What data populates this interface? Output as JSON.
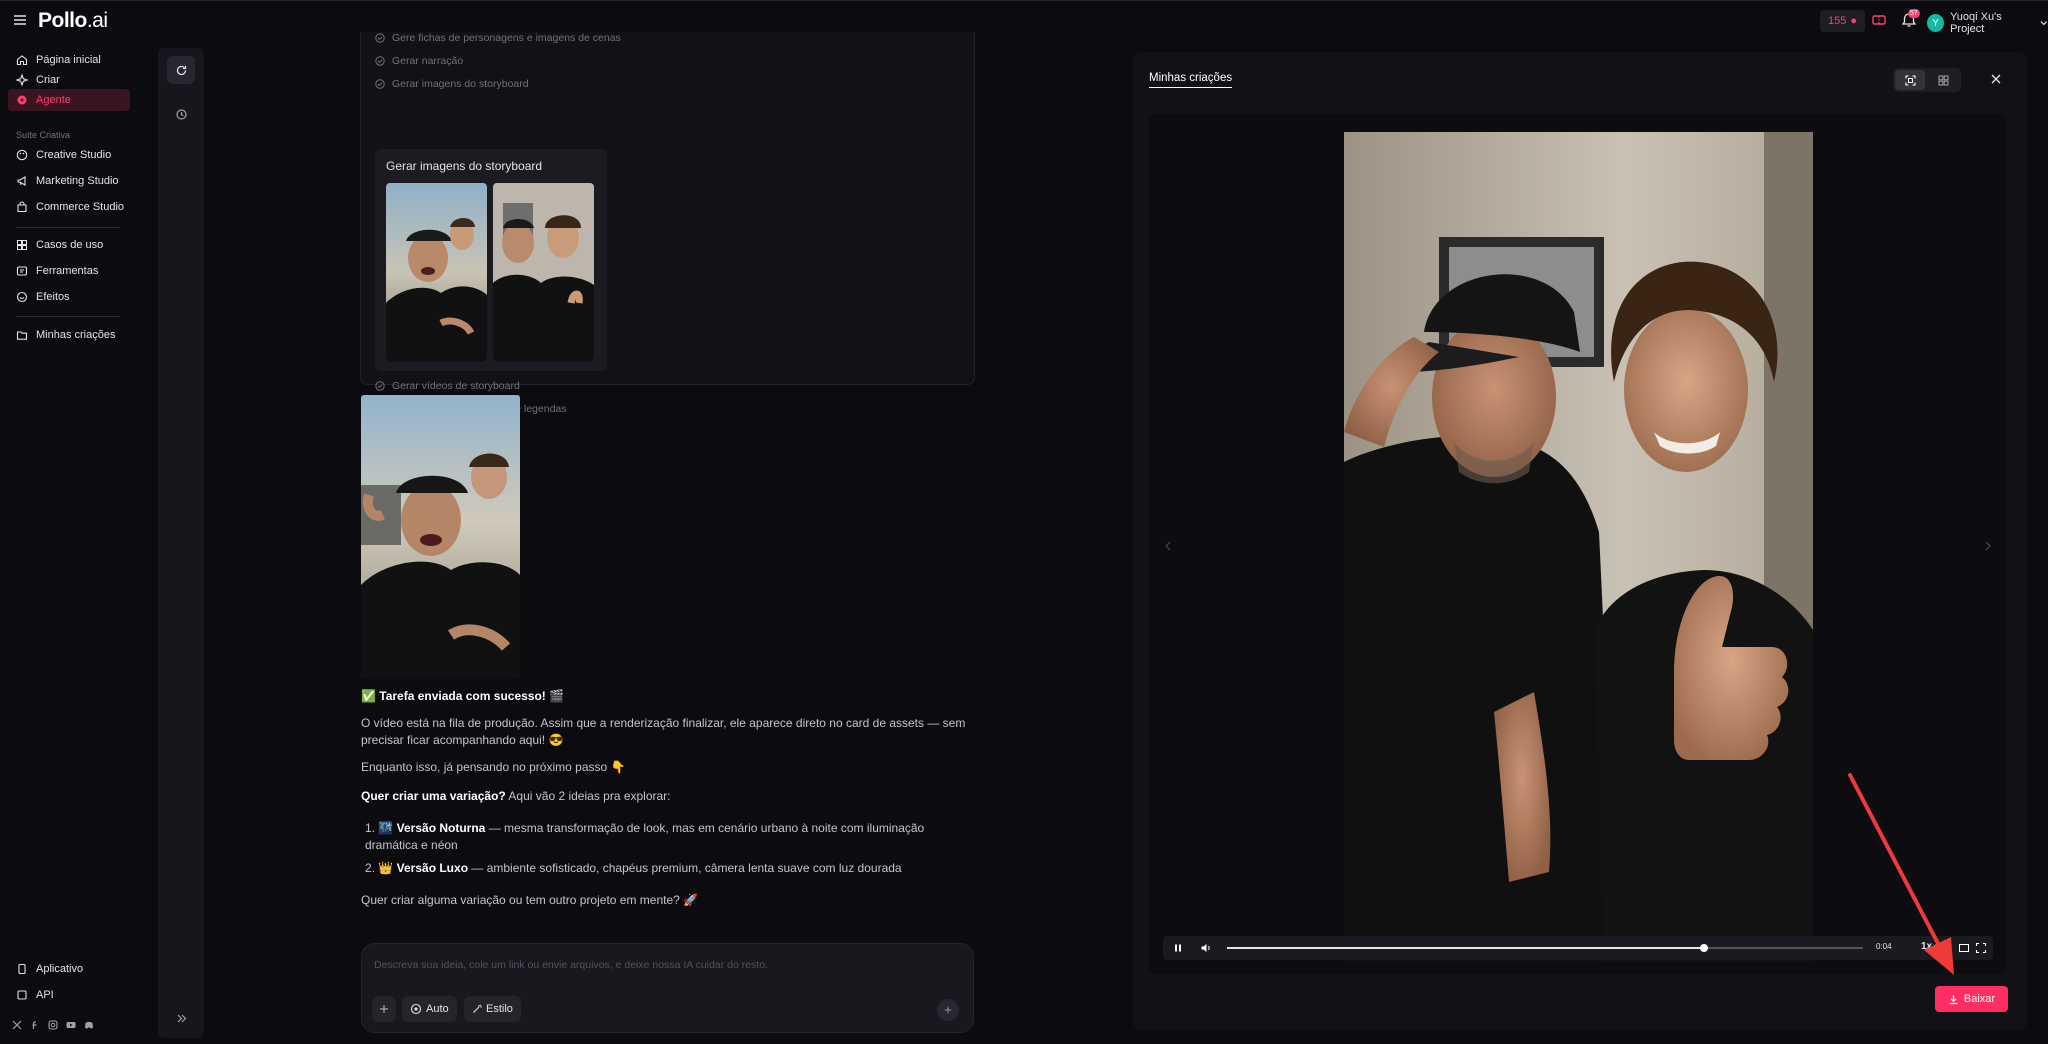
{
  "header": {
    "logo_main": "Pollo",
    "logo_ai": ".ai",
    "credits": "155",
    "notifications_badge": "57",
    "avatar_letter": "Y",
    "project_name": "Yuoqi Xu's Project"
  },
  "sidebar": {
    "home": "Página inicial",
    "create": "Criar",
    "agent": "Agente",
    "section_label": "Suíte Criativa",
    "creative_studio": "Creative Studio",
    "marketing_studio": "Marketing Studio",
    "commerce_studio": "Commerce Studio",
    "use_cases": "Casos de uso",
    "tools": "Ferramentas",
    "effects": "Efeitos",
    "my_creations": "Minhas criações",
    "app": "Aplicativo",
    "api": "API"
  },
  "steps": {
    "step_cut": "Gere fichas de personagens e imagens de cenas",
    "step_narration": "Gerar narração",
    "step_storyboard_images": "Gerar imagens do storyboard",
    "storyboard_card_title": "Gerar imagens do storyboard",
    "step_storyboard_videos": "Gerar vídeos de storyboard",
    "step_assemble": "Montar vídeo com música e legendas"
  },
  "messages": {
    "success": "✅ Tarefa enviada com sucesso! 🎬",
    "queue_text": "O vídeo está na fila de produção. Assim que a renderização finalizar, ele aparece direto no card de assets — sem precisar ficar acompanhando aqui! 😎",
    "meanwhile": "Enquanto isso, já pensando no próximo passo 👇",
    "variation_bold": "Quer criar uma variação?",
    "variation_rest": " Aqui vão 2 ideias pra explorar:",
    "idea1_num": "1.",
    "idea1_emoji": "🌃",
    "idea1_title": "Versão Noturna",
    "idea1_text": " — mesma transformação de look, mas em cenário urbano à noite com iluminação dramática e néon",
    "idea2_num": "2.",
    "idea2_emoji": "👑",
    "idea2_title": "Versão Luxo",
    "idea2_text": " — ambiente sofisticado, chapéus premium, câmera lenta suave com luz dourada",
    "closing": "Quer criar alguma variação ou tem outro projeto em mente? 🚀"
  },
  "composer": {
    "placeholder": "Descreva sua ideia, cole um link ou envie arquivos, e deixe nossa IA cuidar do resto.",
    "auto_label": "Auto",
    "style_label": "Estilo"
  },
  "panel": {
    "tab_label": "Minhas criações",
    "time": "0:04",
    "progress": 0.75,
    "speed": "1x",
    "download_label": "Baixar"
  },
  "colors": {
    "accent": "#ff2e63",
    "background": "#0c0c10"
  }
}
